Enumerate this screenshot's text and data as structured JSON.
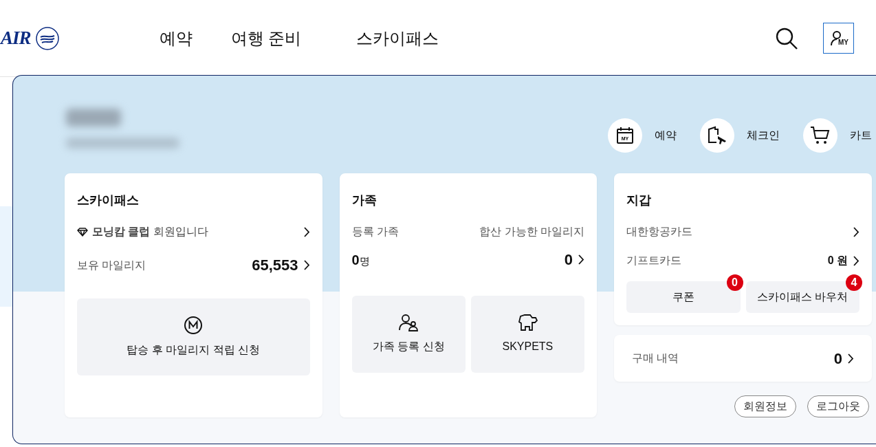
{
  "header": {
    "logo_text": "AIR",
    "nav": [
      "예약",
      "여행 준비",
      "스카이패스"
    ],
    "my_button_text": "MY"
  },
  "panel": {
    "quick_links": [
      {
        "kind": "calendar",
        "icon_text": "MY",
        "label": "예약"
      },
      {
        "kind": "checkin",
        "label": "체크인"
      },
      {
        "kind": "cart",
        "label": "카트"
      }
    ],
    "skypass": {
      "title": "스카이패스",
      "tier": "**모닝캄 클럽** 회원입니다",
      "mileage_label": "보유 마일리지",
      "mileage_value": "65,553",
      "action": "탑승 후 마일리지 적립 신청"
    },
    "family": {
      "title": "가족",
      "registered_label": "등록 가족",
      "combinable_label": "합산 가능한 마일리지",
      "registered_count": "0",
      "registered_unit": "명",
      "combinable_value": "0",
      "actions": [
        {
          "kind": "family",
          "label": "가족 등록 신청"
        },
        {
          "kind": "pet",
          "label": "SKYPETS"
        }
      ]
    },
    "wallet": {
      "title": "지갑",
      "rows": [
        {
          "label": "대한항공카드"
        },
        {
          "label": "기프트카드",
          "value": "0 원"
        }
      ],
      "buttons": [
        {
          "label": "쿠폰",
          "badge": "0"
        },
        {
          "label": "스카이패스 바우처",
          "badge": "4"
        }
      ]
    },
    "purchase": {
      "label": "구매 내역",
      "value": "0"
    },
    "footer_buttons": [
      "회원정보",
      "로그아웃"
    ]
  }
}
